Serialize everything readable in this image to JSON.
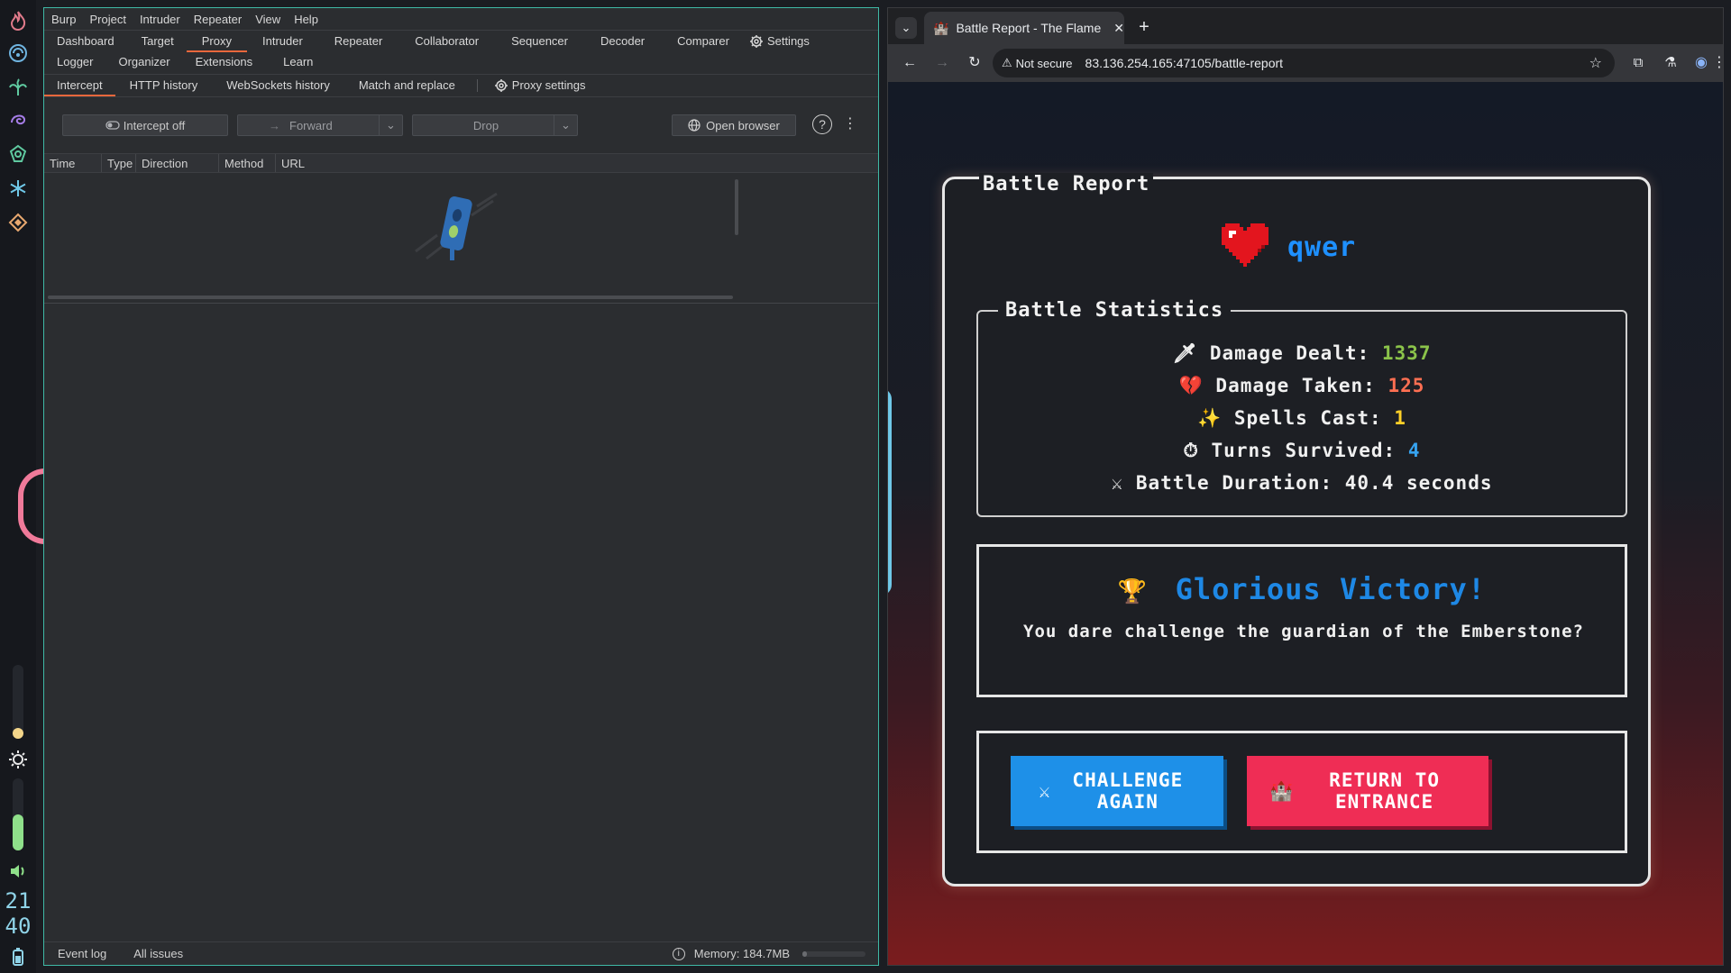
{
  "dock": {
    "clock_hour": "21",
    "clock_minute": "40"
  },
  "burp": {
    "menu": [
      "Burp",
      "Project",
      "Intruder",
      "Repeater",
      "View",
      "Help"
    ],
    "main_tabs": [
      "Dashboard",
      "Target",
      "Proxy",
      "Intruder",
      "Repeater",
      "Collaborator",
      "Sequencer",
      "Decoder",
      "Comparer"
    ],
    "settings_label": "Settings",
    "main_tabs_row2": [
      "Logger",
      "Organizer",
      "Extensions",
      "Learn"
    ],
    "proxy_tabs": [
      "Intercept",
      "HTTP history",
      "WebSockets history",
      "Match and replace"
    ],
    "proxy_settings_label": "Proxy settings",
    "intercept_label": "Intercept off",
    "forward_label": "Forward",
    "drop_label": "Drop",
    "open_browser_label": "Open browser",
    "columns": [
      "Time",
      "Type",
      "Direction",
      "Method",
      "URL"
    ],
    "status": {
      "event_log": "Event log",
      "all_issues": "All issues",
      "memory": "Memory: 184.7MB"
    },
    "accent_color": "#e8673c"
  },
  "chrome": {
    "tab_title": "Battle Report - The Flame",
    "security_label": "Not secure",
    "url": "83.136.254.165:47105/battle-report"
  },
  "game": {
    "card_title": "Battle Report",
    "player_name": "qwer",
    "stats_title": "Battle Statistics",
    "stats": [
      {
        "icon": "dagger-icon",
        "glyph": "🗡",
        "label": "Damage Dealt:",
        "value": "1337",
        "color": "#8bc34a"
      },
      {
        "icon": "broken-heart-icon",
        "glyph": "💔",
        "label": "Damage Taken:",
        "value": "125",
        "color": "#ff6f52"
      },
      {
        "icon": "sparkles-icon",
        "glyph": "✨",
        "label": "Spells Cast:",
        "value": "1",
        "color": "#ffd028"
      },
      {
        "icon": "stopwatch-icon",
        "glyph": "⏱",
        "label": "Turns Survived:",
        "value": "4",
        "color": "#36a3f0"
      },
      {
        "icon": "crossed-swords-icon",
        "glyph": "⚔",
        "label": "Battle Duration:",
        "value": "40.4 seconds",
        "color": "#f0f0f0"
      }
    ],
    "victory_title": "Glorious Victory!",
    "victory_text": "You dare challenge the guardian of the Emberstone?",
    "challenge_label": "CHALLENGE AGAIN",
    "return_label": "RETURN TO ENTRANCE",
    "colors": {
      "player_name": "#1e90ff",
      "victory_title": "#1e88e5",
      "challenge_button": "#1e90e8",
      "return_button": "#ef2d55"
    }
  }
}
